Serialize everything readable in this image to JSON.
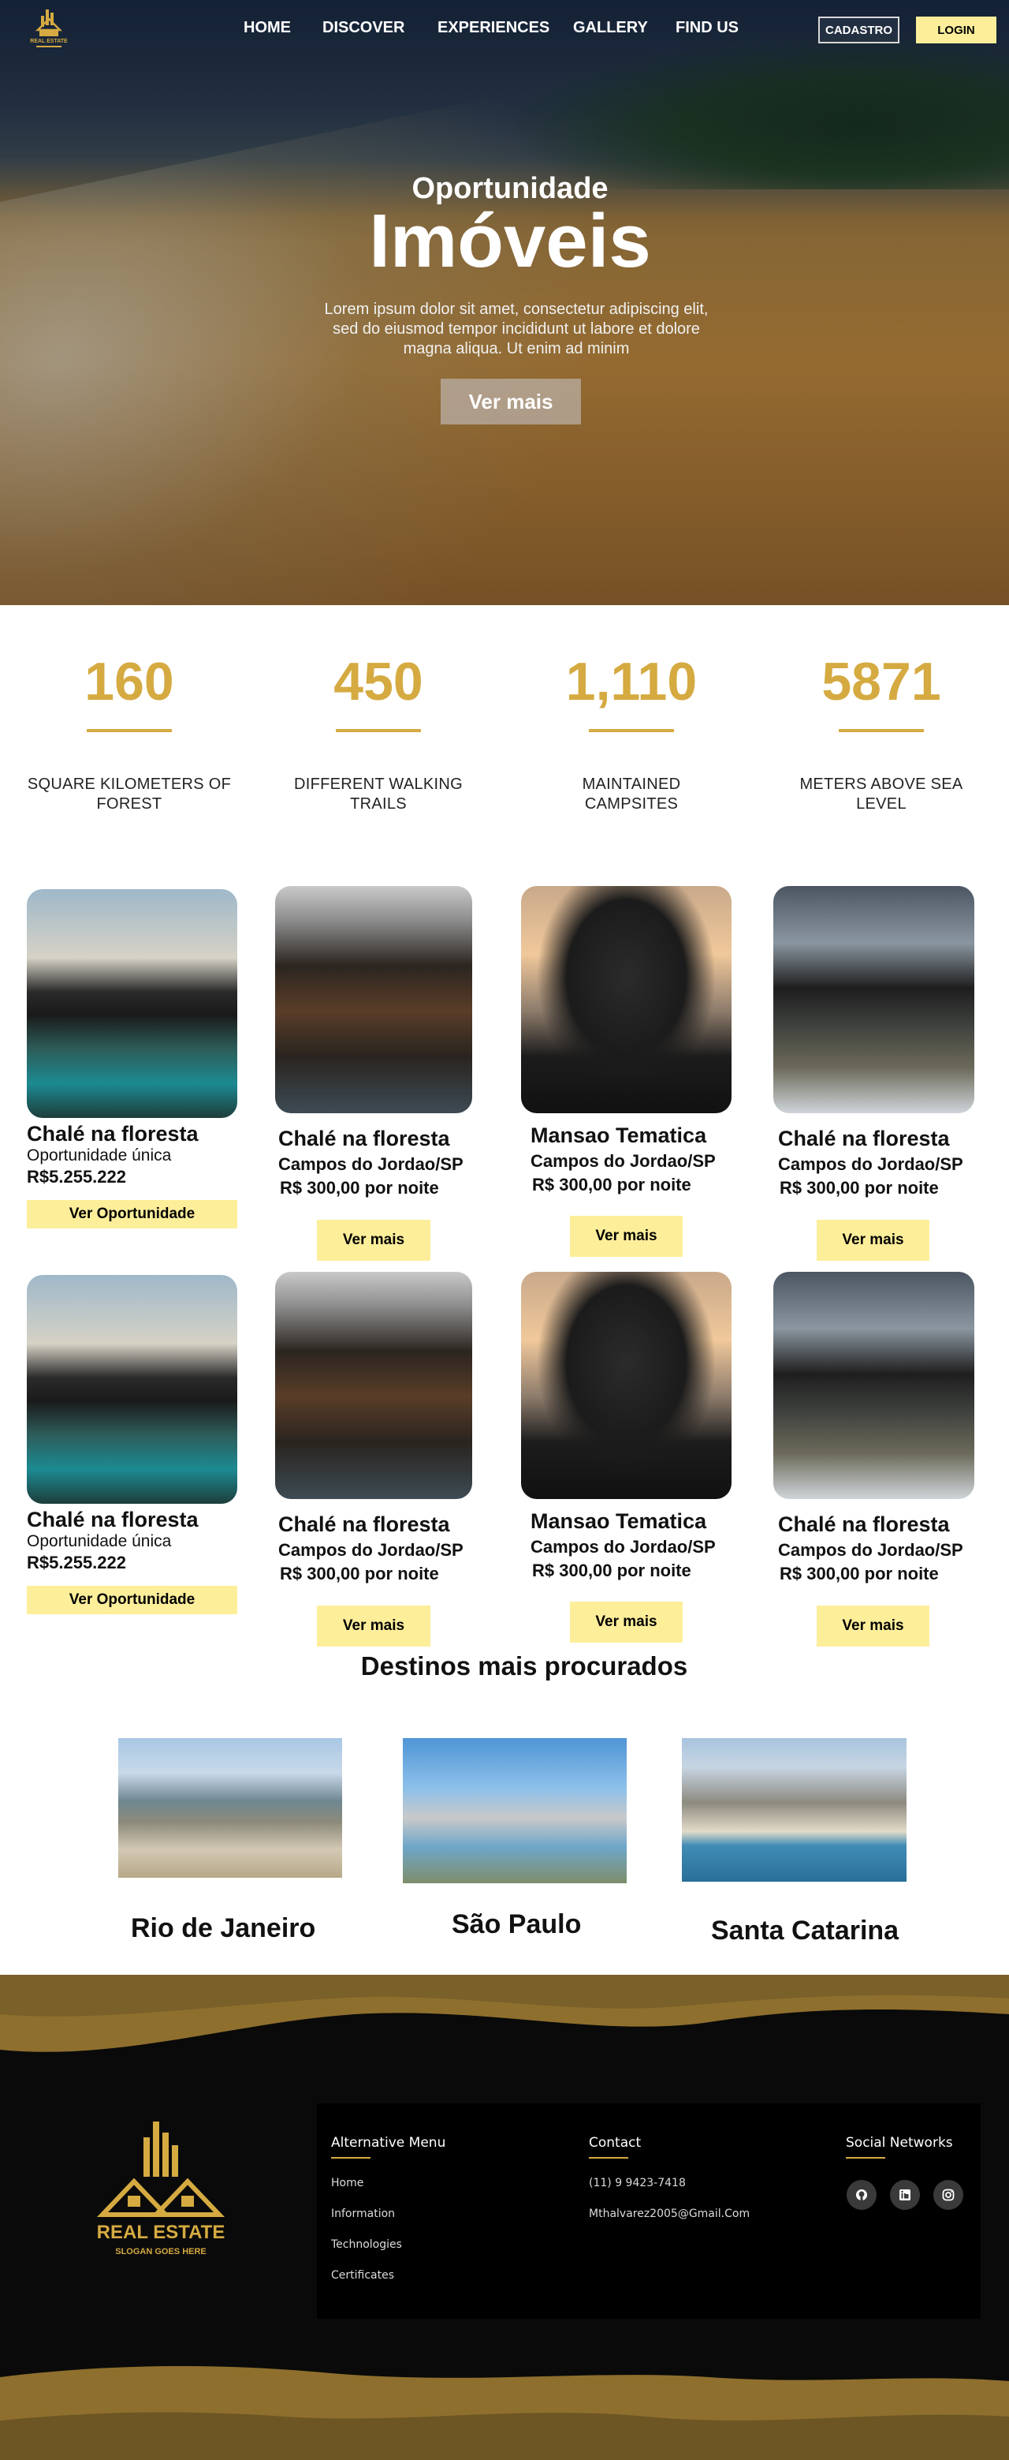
{
  "header": {
    "logo": "REAL ESTATE",
    "nav": [
      "HOME",
      "DISCOVER",
      "EXPERIENCES",
      "GALLERY",
      "FIND US"
    ],
    "cadastro_label": "CADASTRO",
    "login_label": "LOGIN"
  },
  "hero": {
    "subtitle": "Oportunidade",
    "title": "Imóveis",
    "text": "Lorem ipsum dolor sit amet, consectetur adipiscing elit, sed do eiusmod tempor incididunt ut labore et dolore magna aliqua. Ut enim ad minim",
    "button_label": "Ver mais"
  },
  "stats": [
    {
      "value": "160",
      "label": "SQUARE KILOMETERS OF FOREST"
    },
    {
      "value": "450",
      "label": "DIFFERENT WALKING TRAILS"
    },
    {
      "value": "1,110",
      "label": "MAINTAINED CAMPSITES"
    },
    {
      "value": "5871",
      "label": "METERS ABOVE SEA LEVEL"
    }
  ],
  "listings": [
    {
      "title": "Chalé na floresta",
      "subtitle": "Oportunidade única",
      "price": "R$5.255.222",
      "button": "Ver Oportunidade"
    },
    {
      "title": "Chalé na floresta",
      "location": "Campos do Jordao/SP",
      "price": "R$ 300,00 por noite",
      "button": "Ver mais"
    },
    {
      "title": "Mansao Tematica",
      "location": "Campos do Jordao/SP",
      "price": "R$ 300,00 por noite",
      "button": "Ver mais"
    },
    {
      "title": "Chalé na floresta",
      "location": "Campos do Jordao/SP",
      "price": "R$ 300,00 por noite",
      "button": "Ver mais"
    },
    {
      "title": "Chalé na floresta",
      "subtitle": "Oportunidade única",
      "price": "R$5.255.222",
      "button": "Ver Oportunidade"
    },
    {
      "title": "Chalé na floresta",
      "location": "Campos do Jordao/SP",
      "price": "R$ 300,00 por noite",
      "button": "Ver mais"
    },
    {
      "title": "Mansao Tematica",
      "location": "Campos do Jordao/SP",
      "price": "R$ 300,00 por noite",
      "button": "Ver mais"
    },
    {
      "title": "Chalé na floresta",
      "location": "Campos do Jordao/SP",
      "price": "R$ 300,00 por noite",
      "button": "Ver mais"
    }
  ],
  "destinations": {
    "title": "Destinos mais procurados",
    "items": [
      "Rio de Janeiro",
      "São Paulo",
      "Santa Catarina"
    ]
  },
  "footer": {
    "logo_title": "REAL ESTATE",
    "logo_slogan": "SLOGAN GOES HERE",
    "menu_title": "Alternative Menu",
    "menu": [
      "Home",
      "Information",
      "Technologies",
      "Certificates"
    ],
    "contact_title": "Contact",
    "contact": [
      "(11) 9 9423-7418",
      "Mthalvarez2005@Gmail.Com"
    ],
    "social_title": "Social Networks",
    "social_icons": [
      "github-icon",
      "linkedin-icon",
      "instagram-icon"
    ]
  },
  "colors": {
    "accent": "#d5aa41",
    "button_yellow": "#fdee9a",
    "footer_bg": "#0a0a0a"
  }
}
